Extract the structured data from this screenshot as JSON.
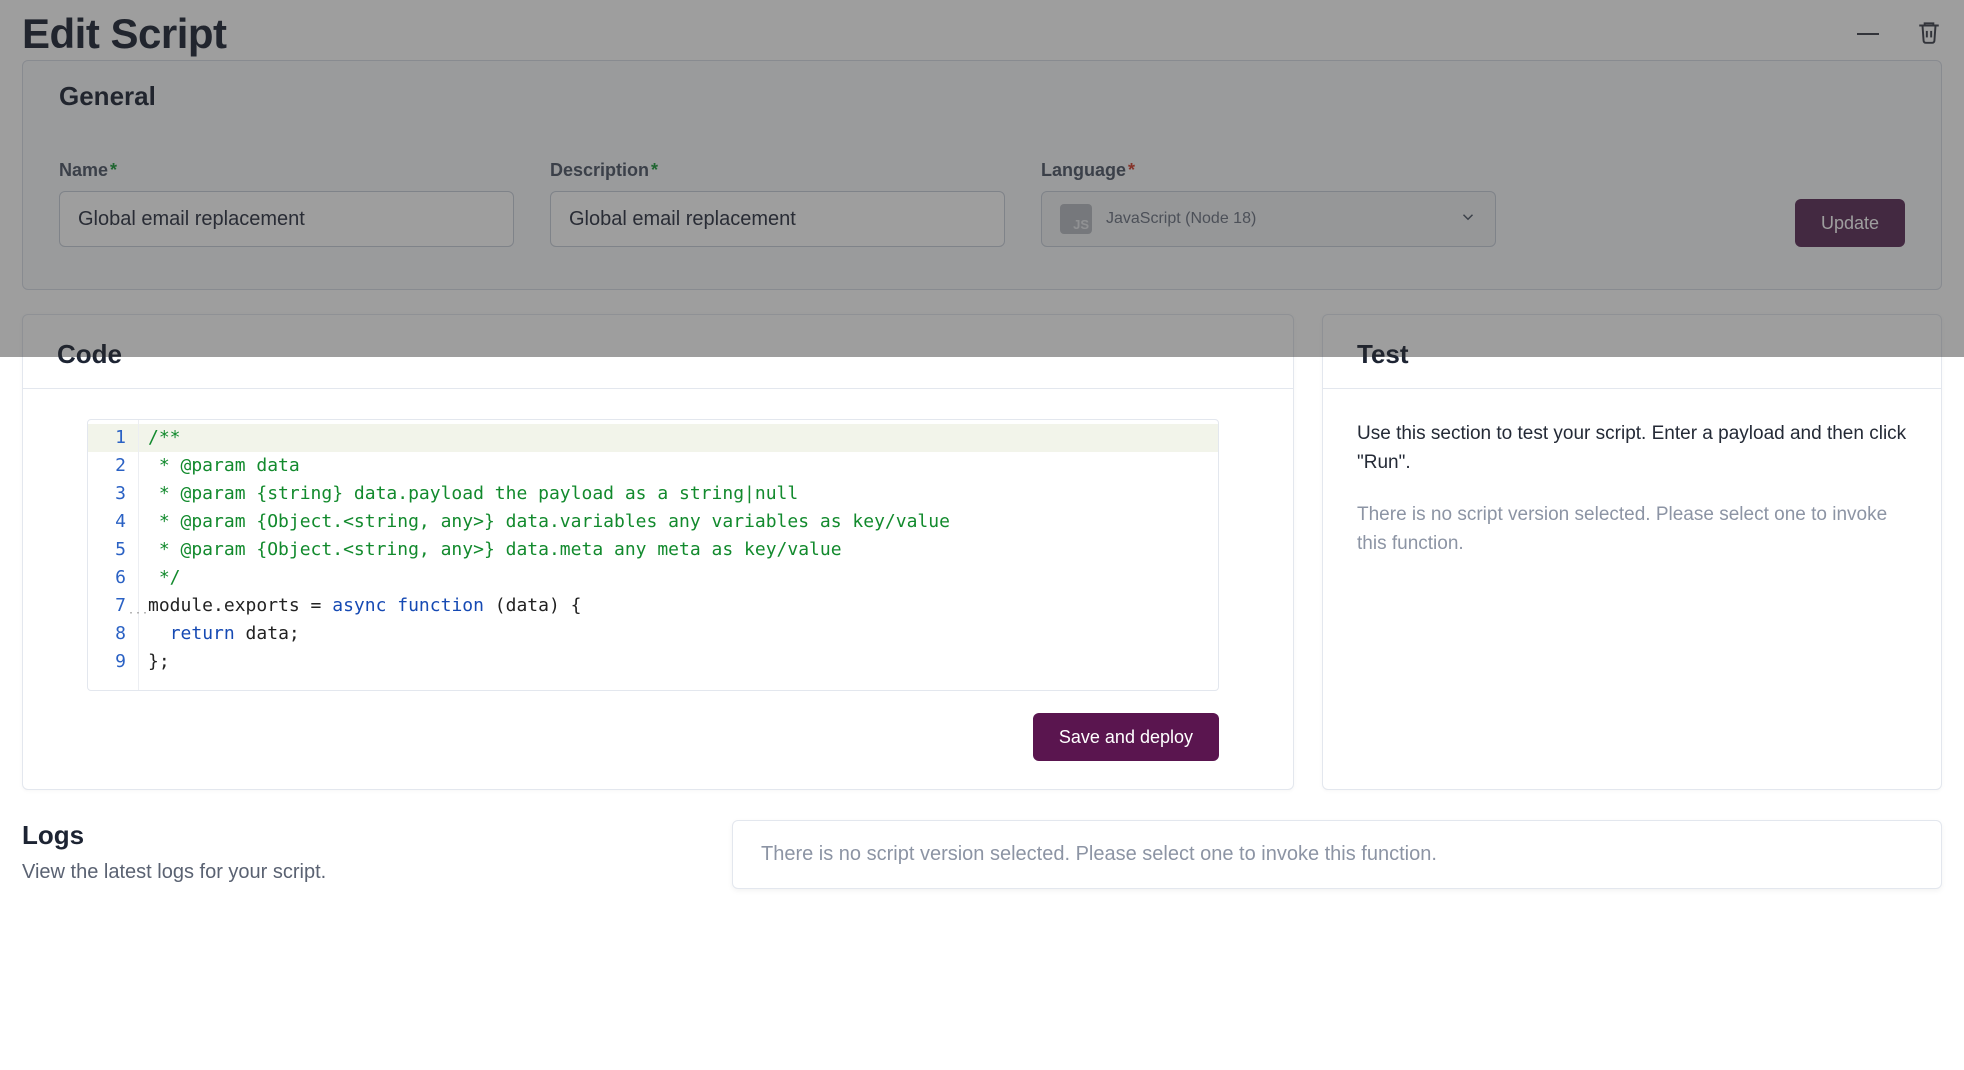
{
  "header": {
    "title": "Edit Script"
  },
  "general": {
    "section_title": "General",
    "name_label": "Name",
    "name_value": "Global email replacement",
    "desc_label": "Description",
    "desc_value": "Global email replacement",
    "lang_label": "Language",
    "lang_badge": "JS",
    "lang_value": "JavaScript (Node 18)",
    "update_label": "Update"
  },
  "code": {
    "section_title": "Code",
    "save_label": "Save and deploy",
    "lines": [
      "/**",
      " * @param data",
      " * @param {string} data.payload the payload as a string|null",
      " * @param {Object.<string, any>} data.variables any variables as key/value",
      " * @param {Object.<string, any>} data.meta any meta as key/value",
      " */",
      "module.exports = async function (data) {",
      "  return data;",
      "};"
    ]
  },
  "test": {
    "section_title": "Test",
    "description": "Use this section to test your script. Enter a payload and then click \"Run\".",
    "empty_message": "There is no script version selected. Please select one to invoke this function."
  },
  "logs": {
    "section_title": "Logs",
    "subtitle": "View the latest logs for your script.",
    "empty_message": "There is no script version selected. Please select one to invoke this function."
  }
}
